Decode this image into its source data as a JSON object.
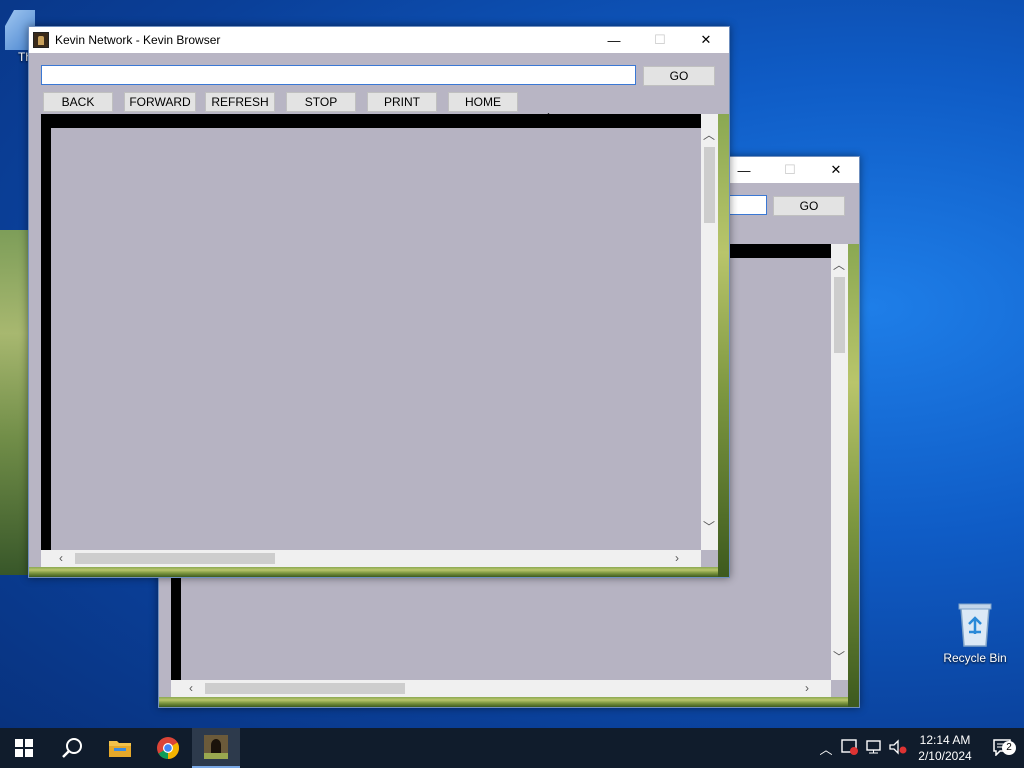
{
  "desktop": {
    "icon_partial_label": "Th",
    "recycle_bin_label": "Recycle Bin"
  },
  "window_front": {
    "title": "Kevin Network - Kevin Browser",
    "url_value": "",
    "go_label": "GO",
    "nav": {
      "back": "BACK",
      "forward": "FORWARD",
      "refresh": "REFRESH",
      "stop": "STOP",
      "print": "PRINT",
      "home": "HOME"
    }
  },
  "window_back": {
    "go_label": "GO"
  },
  "taskbar": {
    "icons": [
      "windows-start-icon",
      "search-icon",
      "file-explorer-icon",
      "chrome-icon",
      "kevin-browser-icon"
    ],
    "time": "12:14 AM",
    "date": "2/10/2024",
    "notification_count": "2"
  }
}
